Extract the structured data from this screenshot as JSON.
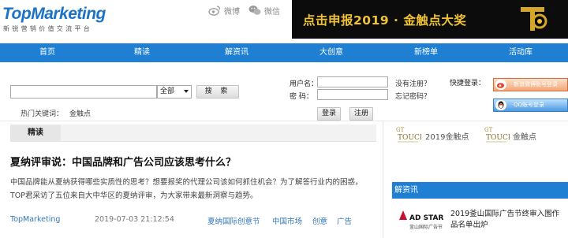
{
  "header": {
    "logo_text": "TopMarketing",
    "logo_subtitle": "新锐营销价值交流平台",
    "weibo_label": "微博",
    "weixin_label": "微信",
    "banner_text": "点击申报2019 · 金触点大奖"
  },
  "nav": {
    "items": [
      "首页",
      "精读",
      "解资讯",
      "大创意",
      "新榜单",
      "活动库"
    ]
  },
  "search": {
    "input_value": "",
    "select_value": "全部",
    "button_label": "搜 索",
    "hot_label": "热门关键词：",
    "hot_keyword": "金触点"
  },
  "login": {
    "username_label": "用户名：",
    "password_label": "密  码：",
    "no_account_link": "没有注册？",
    "forgot_link": "忘记密码？",
    "login_button": "登录",
    "register_button": "注册",
    "quick_label": "快捷登录：",
    "weibo_button": "新浪微博账号登录",
    "qq_button": "QQ账号登录"
  },
  "content": {
    "tab_label": "精读",
    "article": {
      "title": "夏纳评审说：中国品牌和广告公司应该思考什么？",
      "summary": "中国品牌能从夏纳获得哪些实质性的思考？想要报奖的代理公司该如何抓住机会？为了解答行业内的困惑，TOP君采访了五位来自大中华区的夏纳评审，为大家带来最新洞察与趋势。",
      "author": "TopMarketing",
      "date": "2019-07-03 21:12:54",
      "tags": [
        "夏纳国际创意节",
        "中国市场",
        "创意",
        "广告"
      ]
    }
  },
  "sidebar": {
    "promo_left": "2019金触点",
    "promo_right": "金触点",
    "section_title": "解资讯",
    "news_title": "2019釜山国际广告节终审入围作品名单出炉",
    "thumb_text": "AD STARS",
    "thumb_sub": "釜山国际广告节"
  },
  "colors": {
    "nav_blue": "#1f80d3",
    "logo_blue": "#1a73c6",
    "banner_gold": "#f0c235"
  }
}
